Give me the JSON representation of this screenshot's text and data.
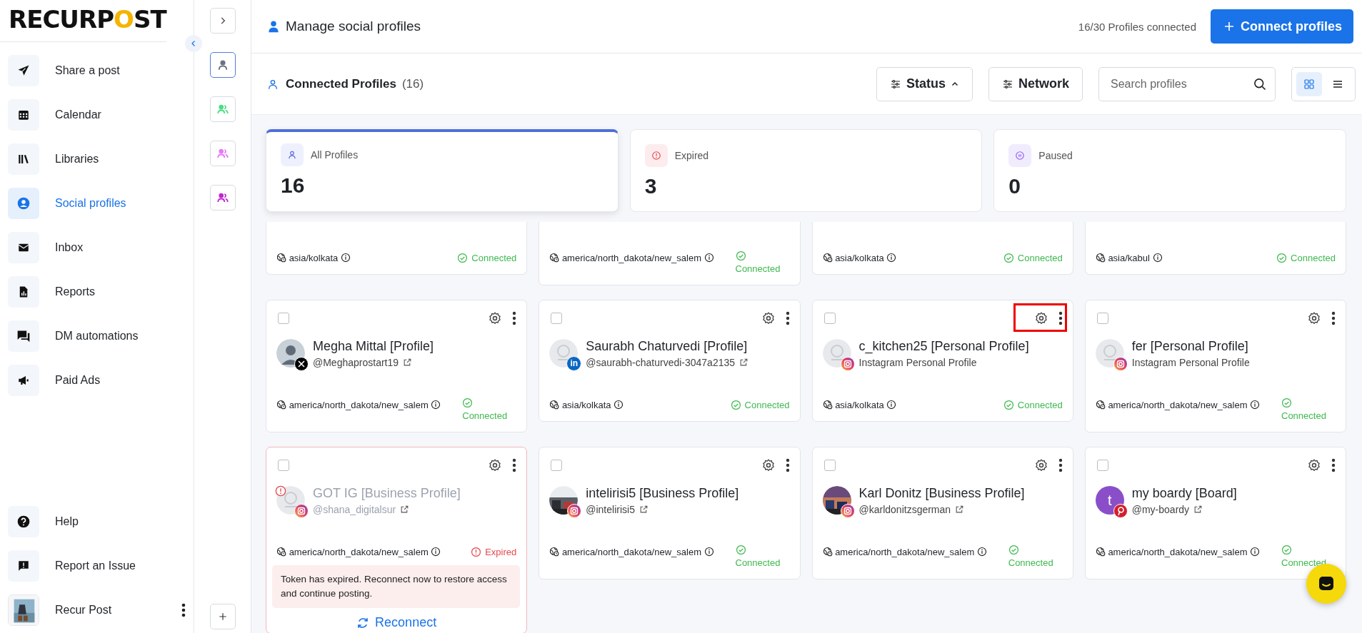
{
  "sidebar": {
    "logo": {
      "before": "RECURP",
      "mark": "O",
      "after": "ST"
    },
    "items": [
      {
        "label": "Share a post",
        "selected": false
      },
      {
        "label": "Calendar",
        "selected": false
      },
      {
        "label": "Libraries",
        "selected": false
      },
      {
        "label": "Social profiles",
        "selected": true
      },
      {
        "label": "Inbox",
        "selected": false
      },
      {
        "label": "Reports",
        "selected": false
      },
      {
        "label": "DM automations",
        "selected": false
      },
      {
        "label": "Paid Ads",
        "selected": false
      }
    ],
    "footer_items": [
      {
        "label": "Help"
      },
      {
        "label": "Report an Issue"
      }
    ],
    "user": {
      "name": "Recur Post"
    }
  },
  "rail": {
    "groups": [
      {
        "color": "#6b7280",
        "selected": true
      },
      {
        "color": "#4ade80",
        "selected": false
      },
      {
        "color": "#e879f9",
        "selected": false
      },
      {
        "color": "#c026d3",
        "selected": false
      }
    ]
  },
  "header": {
    "title": "Manage social profiles",
    "count": "16/30 Profiles connected",
    "button": "Connect profiles"
  },
  "toolbar": {
    "title": "Connected Profiles",
    "count": "(16)",
    "filters": [
      {
        "label": "Status",
        "expanded": true
      },
      {
        "label": "Network",
        "expanded": false
      }
    ],
    "search": {
      "placeholder": "Search profiles"
    },
    "views": [
      {
        "kind": "grid",
        "selected": true
      },
      {
        "kind": "list",
        "selected": false
      }
    ]
  },
  "stats": [
    {
      "kind": "all",
      "label": "All Profiles",
      "value": "16",
      "selected": true
    },
    {
      "kind": "expired",
      "label": "Expired",
      "value": "3",
      "selected": false
    },
    {
      "kind": "paused",
      "label": "Paused",
      "value": "0",
      "selected": false
    }
  ],
  "profiles": [
    {
      "kind": "cut",
      "timezone": "asia/kolkata",
      "status": {
        "kind": "connected",
        "label": "Connected"
      }
    },
    {
      "kind": "cut",
      "timezone": "america/north_dakota/new_salem",
      "status": {
        "kind": "connected",
        "label": "Connected"
      }
    },
    {
      "kind": "cut",
      "timezone": "asia/kolkata",
      "status": {
        "kind": "connected",
        "label": "Connected"
      }
    },
    {
      "kind": "cut",
      "timezone": "asia/kabul",
      "status": {
        "kind": "connected",
        "label": "Connected"
      }
    },
    {
      "kind": "full",
      "checked": false,
      "highlighted": false,
      "avatar": {
        "kind": "silhouette"
      },
      "badge": {
        "kind": "x"
      },
      "name": "Megha Mittal [Profile]",
      "handle": "@Meghaprostart19",
      "external_link": true,
      "timezone": "america/north_dakota/new_salem",
      "status": {
        "kind": "connected",
        "label": "Connected"
      }
    },
    {
      "kind": "full",
      "checked": false,
      "highlighted": false,
      "avatar": {
        "kind": "placeholder"
      },
      "badge": {
        "kind": "linkedin",
        "text": "in"
      },
      "name": "Saurabh Chaturvedi [Profile]",
      "handle": "@saurabh-chaturvedi-3047a2135",
      "external_link": true,
      "timezone": "asia/kolkata",
      "status": {
        "kind": "connected",
        "label": "Connected"
      }
    },
    {
      "kind": "full",
      "checked": false,
      "highlighted": true,
      "avatar": {
        "kind": "placeholder"
      },
      "badge": {
        "kind": "instagram"
      },
      "name": "c_kitchen25 [Personal Profile]",
      "handle": "Instagram Personal Profile",
      "external_link": false,
      "timezone": "asia/kolkata",
      "status": {
        "kind": "connected",
        "label": "Connected"
      }
    },
    {
      "kind": "full",
      "checked": false,
      "highlighted": false,
      "avatar": {
        "kind": "placeholder"
      },
      "badge": {
        "kind": "instagram"
      },
      "name": "fer [Personal Profile]",
      "handle": "Instagram Personal Profile",
      "external_link": false,
      "timezone": "america/north_dakota/new_salem",
      "status": {
        "kind": "connected",
        "label": "Connected"
      }
    },
    {
      "kind": "full",
      "checked": false,
      "highlighted": false,
      "avatar": {
        "kind": "placeholder"
      },
      "badge": {
        "kind": "instagram"
      },
      "name": "GOT IG [Business Profile]",
      "handle": "@shana_digitalsur",
      "external_link": true,
      "timezone": "america/north_dakota/new_salem",
      "status": {
        "kind": "expired",
        "label": "Expired"
      },
      "alert": "Token has expired. Reconnect now to restore access and continue posting.",
      "action": "Reconnect"
    },
    {
      "kind": "full",
      "checked": false,
      "highlighted": false,
      "badge": {
        "kind": "instagram"
      },
      "name": "intelirisi5 [Business Profile]",
      "handle": "@intelirisi5",
      "external_link": true,
      "timezone": "america/north_dakota/new_salem",
      "status": {
        "kind": "connected",
        "label": "Connected"
      }
    },
    {
      "kind": "full",
      "checked": false,
      "highlighted": false,
      "badge": {
        "kind": "instagram"
      },
      "name": "Karl Donitz [Business Profile]",
      "handle": "@karldonitzsgerman",
      "external_link": true,
      "timezone": "america/north_dakota/new_salem",
      "status": {
        "kind": "connected",
        "label": "Connected"
      }
    },
    {
      "kind": "full",
      "checked": false,
      "highlighted": false,
      "avatar": {
        "kind": "letter",
        "text": "t"
      },
      "badge": {
        "kind": "pinterest"
      },
      "name": "my boardy [Board]",
      "handle": "@my-boardy",
      "external_link": true,
      "timezone": "america/north_dakota/new_salem",
      "status": {
        "kind": "connected",
        "label": "Connected"
      }
    }
  ]
}
